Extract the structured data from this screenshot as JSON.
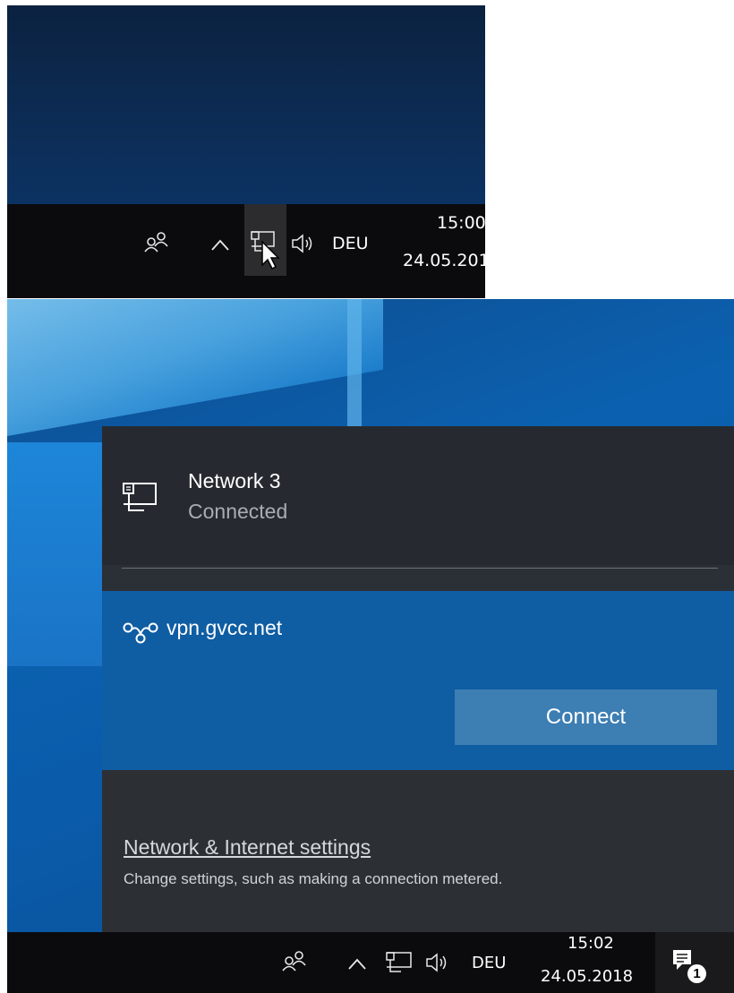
{
  "top": {
    "taskbar": {
      "people_icon": "people-icon",
      "overflow_icon": "chevron-up-icon",
      "network_icon": "ethernet-network-icon",
      "volume_icon": "speaker-volume-icon",
      "language": "DEU",
      "time": "15:00",
      "date": "24.05.201"
    }
  },
  "flyout": {
    "network": {
      "name": "Network 3",
      "status": "Connected",
      "icon": "ethernet-network-icon"
    },
    "vpn": {
      "name": "vpn.gvcc.net",
      "icon": "vpn-icon",
      "connect_label": "Connect"
    },
    "settings": {
      "link": "Network & Internet settings",
      "description": "Change settings, such as making a connection metered."
    }
  },
  "bottom": {
    "taskbar": {
      "language": "DEU",
      "time": "15:02",
      "date": "24.05.2018",
      "notification_count": "1"
    }
  },
  "colors": {
    "flyout_bg": "#2b2f36",
    "vpn_accent": "#0f5da3",
    "connect_button": "#3d7eb3",
    "taskbar": "#0b0b0d"
  }
}
